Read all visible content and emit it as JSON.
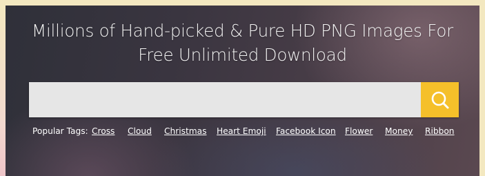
{
  "headline": {
    "line1": "Millions of Hand-picked & Pure HD PNG Images For",
    "line2": "Free Unlimited Download"
  },
  "search": {
    "value": "",
    "placeholder": "",
    "button_icon": "search-icon"
  },
  "popular_tags": {
    "label": "Popular Tags:",
    "items": [
      "Cross",
      "Cloud",
      "Christmas",
      "Heart Emoji",
      "Facebook Icon",
      "Flower",
      "Money",
      "Ribbon"
    ]
  },
  "colors": {
    "accent": "#f5c02a",
    "search_field": "#e6e6e6",
    "hero_background": "#3a3540",
    "text": "#ffffff",
    "page_border": "#f3e8c0"
  }
}
